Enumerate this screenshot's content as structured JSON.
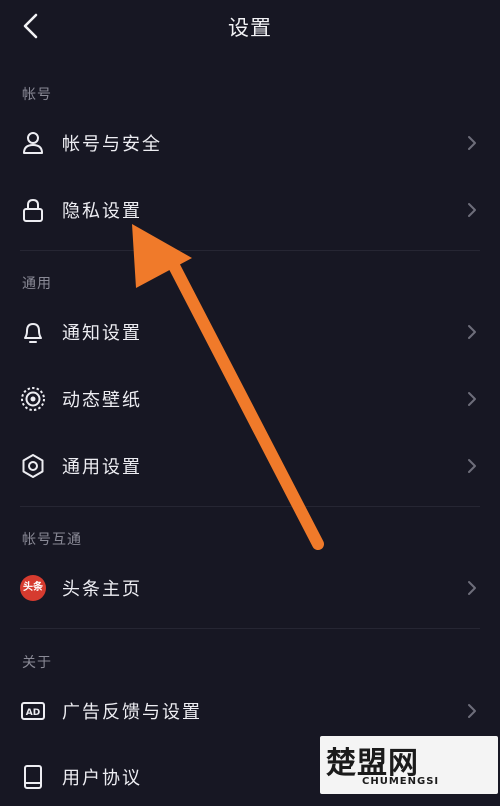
{
  "header": {
    "title": "设置",
    "back_icon": "chevron-left-icon"
  },
  "sections": {
    "account": "帐号",
    "general": "通用",
    "linked": "帐号互通",
    "about": "关于"
  },
  "items": {
    "account_security": {
      "label": "帐号与安全",
      "icon": "user-icon"
    },
    "privacy": {
      "label": "隐私设置",
      "icon": "lock-icon"
    },
    "notifications": {
      "label": "通知设置",
      "icon": "bell-icon"
    },
    "live_wallpaper": {
      "label": "动态壁纸",
      "icon": "wallpaper-icon"
    },
    "general_settings": {
      "label": "通用设置",
      "icon": "gear-icon"
    },
    "toutiao_home": {
      "label": "头条主页",
      "icon": "toutiao-logo-icon",
      "badge": "头条"
    },
    "ad_feedback": {
      "label": "广告反馈与设置",
      "icon": "ad-icon",
      "badge": "AD"
    },
    "user_agreement": {
      "label": "用户协议",
      "icon": "book-icon"
    }
  },
  "annotation": {
    "color": "#f07a2a"
  },
  "watermark": {
    "text": "楚盟网",
    "subtext": "CHUMENGSI"
  }
}
